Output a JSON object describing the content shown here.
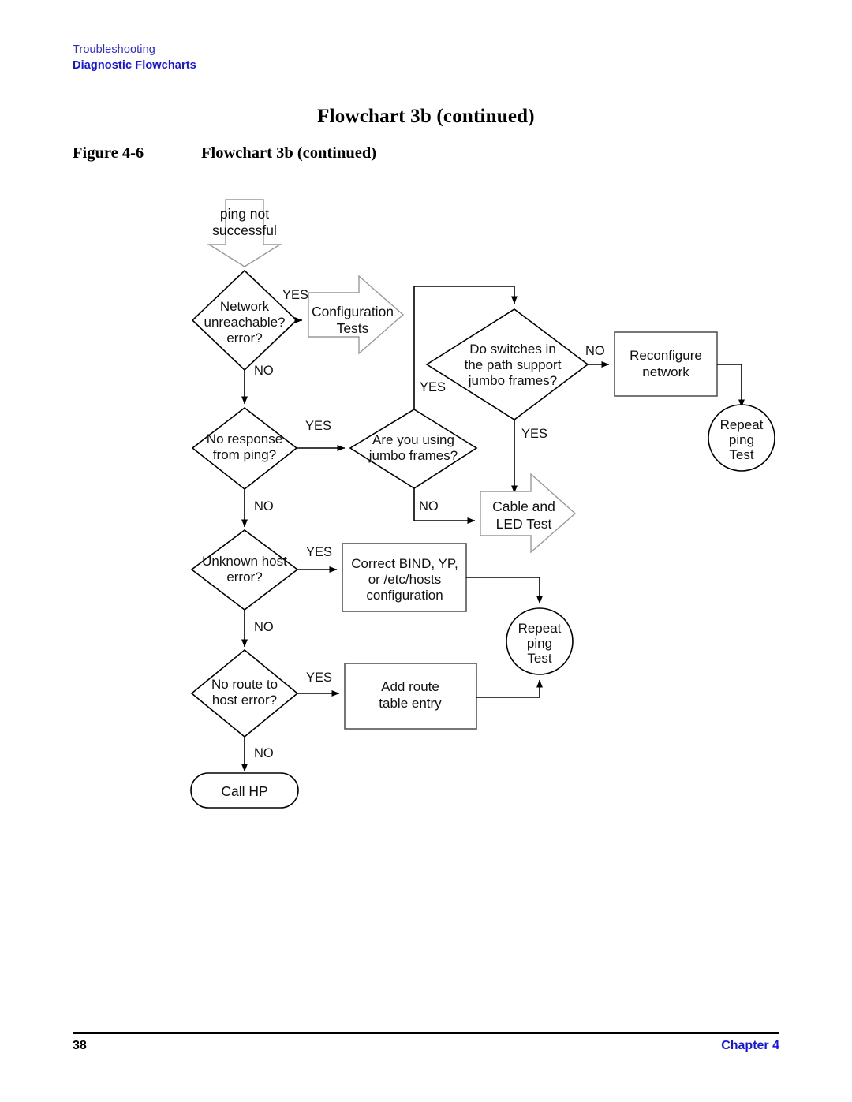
{
  "page": {
    "running_header_top": "Troubleshooting",
    "running_header_bottom": "Diagnostic Flowcharts",
    "title": "Flowchart 3b (continued)",
    "figure_label": "Figure 4-6",
    "figure_caption": "Flowchart 3b (continued)",
    "page_number": "38",
    "chapter_label": "Chapter 4",
    "header_color": "#1414e6",
    "footer_rule_color": "#000000"
  },
  "flowchart": {
    "nodes": {
      "start_arrow": {
        "label_line1": "ping not",
        "label_line2": "successful",
        "shape": "down-arrow"
      },
      "network_unreachable": {
        "label_line1": "Network",
        "label_line2": "unreachable?",
        "label_line3": "error?",
        "shape": "diamond"
      },
      "configuration_tests": {
        "label_line1": "Configuration",
        "label_line2": "Tests",
        "shape": "right-arrow"
      },
      "switches_jumbo": {
        "label_line1": "Do switches in",
        "label_line2": "the path support",
        "label_line3": "jumbo frames?",
        "shape": "diamond"
      },
      "reconfigure_network": {
        "label_line1": "Reconfigure",
        "label_line2": "network",
        "shape": "rect"
      },
      "repeat_ping_test_top": {
        "label_line1": "Repeat",
        "label_line2": "ping",
        "label_line3": "Test",
        "shape": "circle"
      },
      "no_response_from_ping": {
        "label_line1": "No response",
        "label_line2": "from ping?",
        "shape": "diamond"
      },
      "are_you_using_jumbo": {
        "label_line1": "Are you using",
        "label_line2": "jumbo frames?",
        "shape": "diamond"
      },
      "cable_led_test": {
        "label_line1": "Cable and",
        "label_line2": "LED Test",
        "shape": "right-arrow"
      },
      "unknown_host_error": {
        "label_line1": "Unknown host",
        "label_line2": "error?",
        "shape": "diamond"
      },
      "correct_bind_yp": {
        "label_line1": "Correct BIND, YP,",
        "label_line2": "or /etc/hosts",
        "label_line3": "configuration",
        "shape": "rect"
      },
      "repeat_ping_test_bottom": {
        "label_line1": "Repeat",
        "label_line2": "ping",
        "label_line3": "Test",
        "shape": "circle"
      },
      "no_route_to_host": {
        "label_line1": "No route to",
        "label_line2": "host error?",
        "shape": "diamond"
      },
      "add_route_table_entry": {
        "label_line1": "Add route",
        "label_line2": "table entry",
        "shape": "rect"
      },
      "call_hp": {
        "label": "Call HP",
        "shape": "stadium"
      }
    },
    "edge_labels": {
      "network_unreachable_yes": "YES",
      "network_unreachable_no": "NO",
      "no_response_yes": "YES",
      "no_response_no": "NO",
      "are_you_using_jumbo_yes": "YES",
      "are_you_using_jumbo_no": "NO",
      "switches_jumbo_no": "NO",
      "switches_jumbo_yes": "YES",
      "unknown_host_yes": "YES",
      "unknown_host_no": "NO",
      "no_route_yes": "YES",
      "no_route_no": "NO"
    }
  }
}
